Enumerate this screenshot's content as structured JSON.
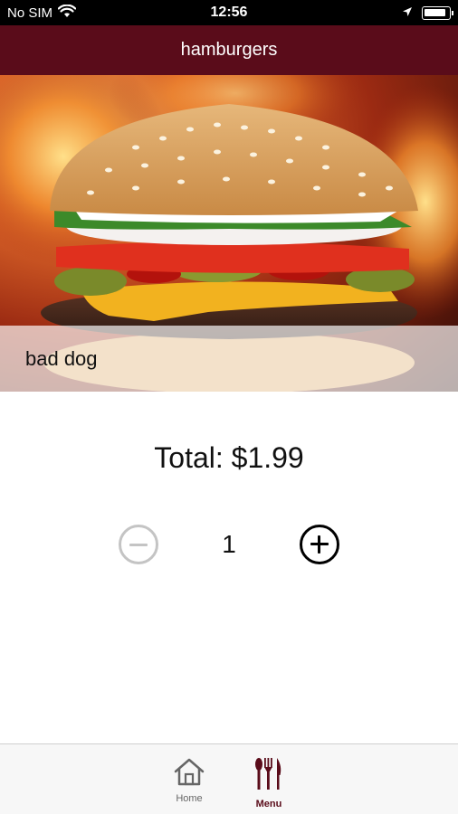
{
  "status_bar": {
    "carrier": "No SIM",
    "time": "12:56",
    "icons": [
      "wifi-icon",
      "location-arrow-icon",
      "battery-icon"
    ],
    "battery_level": 0.9
  },
  "nav": {
    "title": "hamburgers"
  },
  "hero": {
    "image": "hamburger-over-flames",
    "caption": "bad dog"
  },
  "order": {
    "total_text": "Total: $1.99",
    "quantity": "1",
    "minus_icon": "minus-circle-icon",
    "plus_icon": "plus-circle-icon"
  },
  "tab_bar": {
    "items": [
      {
        "label": "Home",
        "icon": "home-icon",
        "active": false
      },
      {
        "label": "Menu",
        "icon": "fork-knife-icon",
        "active": true
      }
    ]
  },
  "colors": {
    "brand": "#5a0c1a",
    "disabled": "#c4c4c4",
    "tab_bar_bg": "#f7f7f7"
  }
}
